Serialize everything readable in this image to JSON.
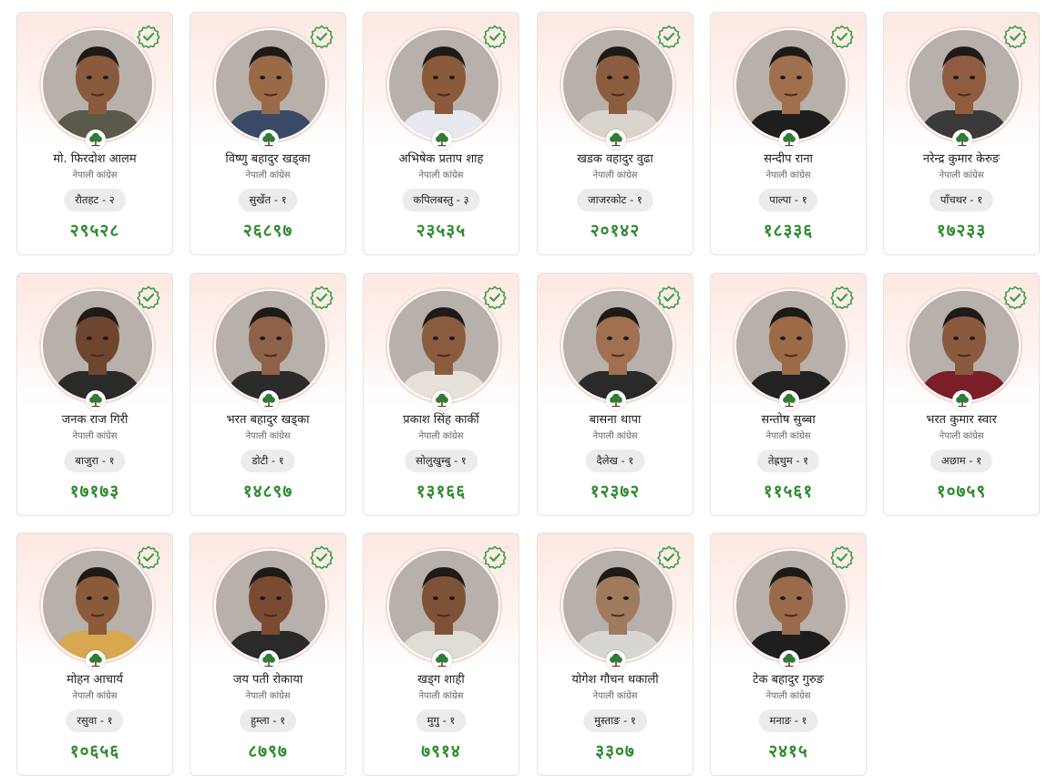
{
  "colors": {
    "vote_green": "#2e8b2e",
    "check_green": "#3aa04a",
    "card_tint": "#fde8e2",
    "pill_bg": "#ececec"
  },
  "icons": {
    "winner": "verified-check-icon",
    "party": "tree-icon"
  },
  "candidates": [
    {
      "name": "मो. फिरदोश आलम",
      "party": "नेपाली कांग्रेस",
      "constituency": "रौतहट - २",
      "votes": "२९५२८",
      "shirt": "#5a5a4a",
      "skin": "#8a5a3c"
    },
    {
      "name": "विष्णु बहादुर खड्का",
      "party": "नेपाली कांग्रेस",
      "constituency": "सुर्खेत - १",
      "votes": "२६८९७",
      "shirt": "#3a4a66",
      "skin": "#9a6a48"
    },
    {
      "name": "अभिषेक प्रताप शाह",
      "party": "नेपाली कांग्रेस",
      "constituency": "कपिलबस्तु - ३",
      "votes": "२३५३५",
      "shirt": "#e8e8f0",
      "skin": "#8a5a3a"
    },
    {
      "name": "खडक वहादुर वुढा",
      "party": "नेपाली कांग्रेस",
      "constituency": "जाजरकोट - १",
      "votes": "२०१४२",
      "shirt": "#d9d4cc",
      "skin": "#8c5c3e"
    },
    {
      "name": "सन्दीप राना",
      "party": "नेपाली कांग्रेस",
      "constituency": "पाल्पा - १",
      "votes": "१८३३६",
      "shirt": "#1e1e1e",
      "skin": "#a0704e"
    },
    {
      "name": "नरेन्द्र कुमार केरुङ",
      "party": "नेपाली कांग्रेस",
      "constituency": "पाँचथर - १",
      "votes": "१७२३३",
      "shirt": "#3a3a3a",
      "skin": "#8f5c40"
    },
    {
      "name": "जनक राज गिरी",
      "party": "नेपाली कांग्रेस",
      "constituency": "बाजुरा - १",
      "votes": "१७१७३",
      "shirt": "#2a2a2a",
      "skin": "#6e4630"
    },
    {
      "name": "भरत बहादुर खड्का",
      "party": "नेपाली कांग्रेस",
      "constituency": "डोटी - १",
      "votes": "१४८९७",
      "shirt": "#2b2b2b",
      "skin": "#8e6248"
    },
    {
      "name": "प्रकाश सिंह कार्की",
      "party": "नेपाली कांग्रेस",
      "constituency": "सोलुखुम्बु - १",
      "votes": "१३१६६",
      "shirt": "#e6e2da",
      "skin": "#8a5c3e"
    },
    {
      "name": "बासना थापा",
      "party": "नेपाली कांग्रेस",
      "constituency": "दैलेख - १",
      "votes": "१२३७२",
      "shirt": "#2a2a2a",
      "skin": "#a07050"
    },
    {
      "name": "सन्तोष सुब्बा",
      "party": "नेपाली कांग्रेस",
      "constituency": "तेह्रथुम - १",
      "votes": "११५६१",
      "shirt": "#222222",
      "skin": "#9c6a46"
    },
    {
      "name": "भरत कुमार स्वार",
      "party": "नेपाली कांग्रेस",
      "constituency": "अछाम - १",
      "votes": "१०७५९",
      "shirt": "#7a1f2a",
      "skin": "#8a5a3e"
    },
    {
      "name": "मोहन आचार्य",
      "party": "नेपाली कांग्रेस",
      "constituency": "रसुवा - १",
      "votes": "१०६५६",
      "shirt": "#d8a850",
      "skin": "#8a5a3a"
    },
    {
      "name": "जय पती रोकाया",
      "party": "नेपाली कांग्रेस",
      "constituency": "हुम्ला - १",
      "votes": "८७९७",
      "shirt": "#2a2a2a",
      "skin": "#7a4a32"
    },
    {
      "name": "खड्ग शाही",
      "party": "नेपाली कांग्रेस",
      "constituency": "मुगु - १",
      "votes": "७९१४",
      "shirt": "#e0dcd6",
      "skin": "#7e5236"
    },
    {
      "name": "योगेश गौचन थकाली",
      "party": "नेपाली कांग्रेस",
      "constituency": "मुस्ताङ - १",
      "votes": "३३०७",
      "shirt": "#d8d6d2",
      "skin": "#a07a5c"
    },
    {
      "name": "टेक बहादुर गुरुङ",
      "party": "नेपाली कांग्रेस",
      "constituency": "मनाङ - १",
      "votes": "२४१५",
      "shirt": "#1e1e1e",
      "skin": "#9a6a4a"
    }
  ]
}
